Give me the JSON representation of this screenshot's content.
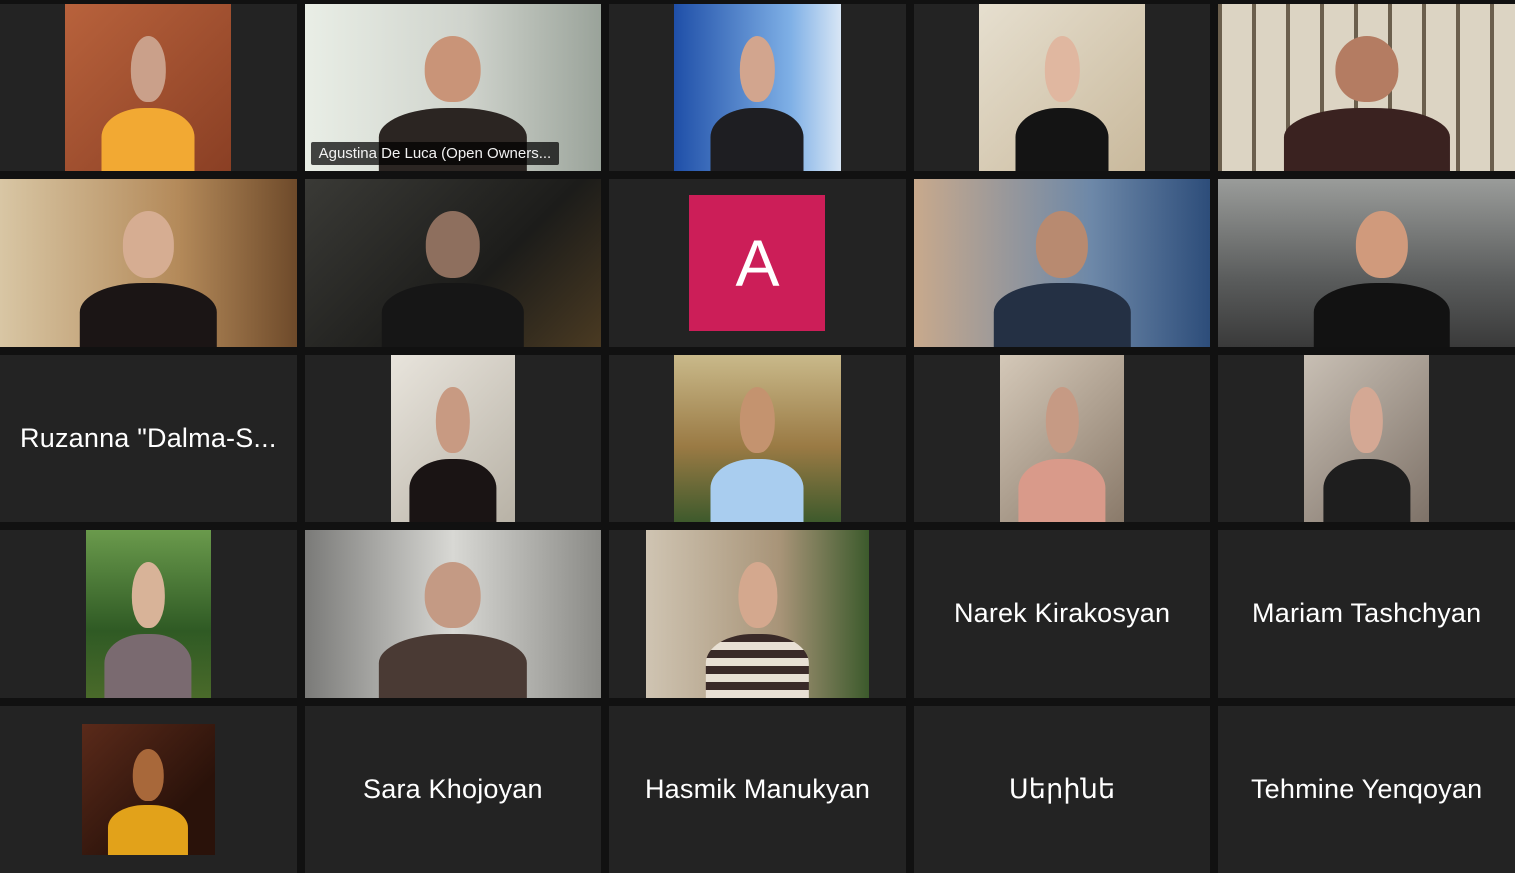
{
  "meeting": {
    "active_speaker_name": "Agustina De Luca (Open Owners...",
    "avatar_participant": {
      "initial": "A",
      "color": "#cc1e58"
    },
    "name_only_tiles": [
      "Ruzanna \"Dalma-S...",
      "Narek Kirakosyan",
      "Mariam Tashchyan",
      "Sara Khojoyan",
      "Hasmik Manukyan",
      "Սերինե",
      "Tehmine Yenqoyan"
    ],
    "colors": {
      "tile_background": "#232323",
      "grid_background": "#111111",
      "active_speaker_border": "#d6e65a"
    }
  }
}
